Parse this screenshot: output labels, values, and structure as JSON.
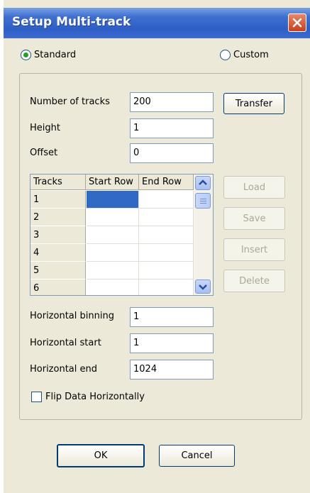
{
  "window": {
    "title": "Setup Multi-track"
  },
  "mode": {
    "standard_label": "Standard",
    "custom_label": "Custom",
    "selected": "Standard"
  },
  "fields": {
    "num_tracks": {
      "label": "Number of tracks",
      "value": "200"
    },
    "height": {
      "label": "Height",
      "value": "1"
    },
    "offset": {
      "label": "Offset",
      "value": "0"
    },
    "h_binning": {
      "label": "Horizontal binning",
      "value": "1"
    },
    "h_start": {
      "label": "Horizontal start",
      "value": "1"
    },
    "h_end": {
      "label": "Horizontal end",
      "value": "1024"
    }
  },
  "buttons": {
    "transfer": "Transfer",
    "load": "Load",
    "save": "Save",
    "insert": "Insert",
    "delete": "Delete",
    "ok": "OK",
    "cancel": "Cancel"
  },
  "grid": {
    "headers": [
      "Tracks",
      "Start Row",
      "End Row"
    ],
    "rows": [
      "1",
      "2",
      "3",
      "4",
      "5",
      "6"
    ]
  },
  "flip": {
    "label": "Flip Data Horizontally",
    "checked": false
  },
  "icons": {
    "close": "close-icon",
    "scroll_up": "chevron-up-icon",
    "scroll_down": "chevron-down-icon"
  }
}
